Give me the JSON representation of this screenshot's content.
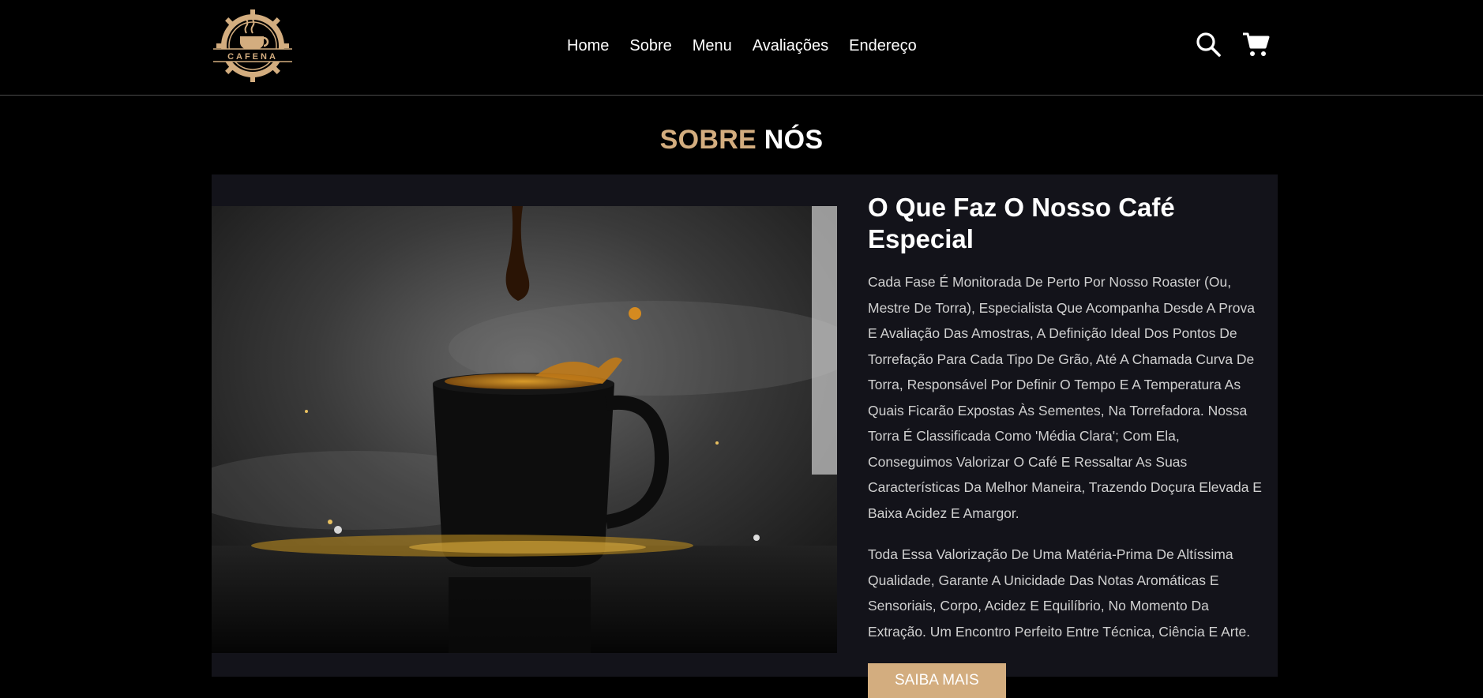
{
  "brand": {
    "logo_text": "CAFENA",
    "accent_color": "#d3ad7f"
  },
  "nav": {
    "items": [
      {
        "label": "Home"
      },
      {
        "label": "Sobre"
      },
      {
        "label": "Menu"
      },
      {
        "label": "Avaliações"
      },
      {
        "label": "Endereço"
      }
    ]
  },
  "header_icons": {
    "search": "search-icon",
    "cart": "cart-icon"
  },
  "about": {
    "title_accent": "SOBRE",
    "title_rest": "NÓS",
    "heading": "O Que Faz O Nosso Café Especial",
    "paragraph_1": "Cada Fase É Monitorada De Perto Por Nosso Roaster (Ou, Mestre De Torra), Especialista Que Acompanha Desde A Prova E Avaliação Das Amostras, A Definição Ideal Dos Pontos De Torrefação Para Cada Tipo De Grão, Até A Chamada Curva De Torra, Responsável Por Definir O Tempo E A Temperatura As Quais Ficarão Expostas Às Sementes, Na Torrefadora. Nossa Torra É Classificada Como 'Média Clara'; Com Ela, Conseguimos Valorizar O Café E Ressaltar As Suas Características Da Melhor Maneira, Trazendo Doçura Elevada E Baixa Acidez E Amargor.",
    "paragraph_2": "Toda Essa Valorização De Uma Matéria-Prima De Altíssima Qualidade, Garante A Unicidade Das Notas Aromáticas E Sensoriais, Corpo, Acidez E Equilíbrio, No Momento Da Extração. Um Encontro Perfeito Entre Técnica, Ciência E Arte.",
    "button_label": "SAIBA MAIS"
  }
}
